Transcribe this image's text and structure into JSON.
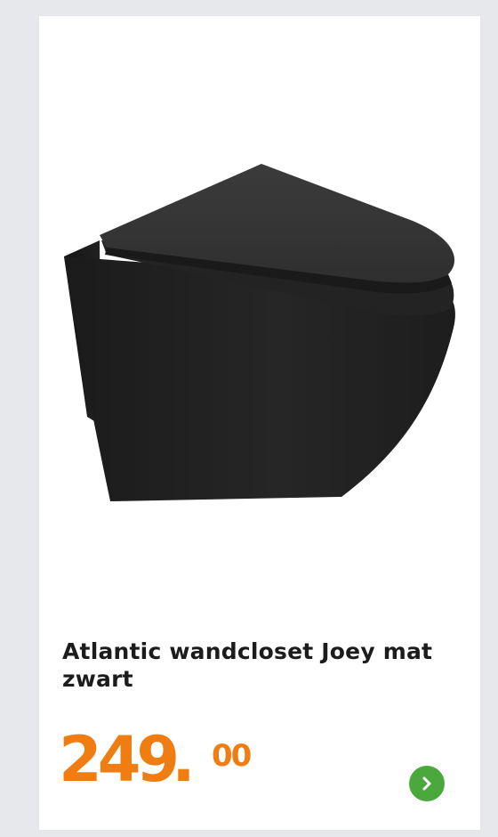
{
  "product": {
    "title": "Atlantic wandcloset Joey mat zwart",
    "price": {
      "main": "249",
      "dot": ".",
      "cents": "00"
    },
    "image_icon": "wall-toilet-image",
    "next_icon": "chevron-right-icon"
  },
  "colors": {
    "price": "#f07d12",
    "next_button": "#4aa83c",
    "background": "#e6e8ec",
    "card": "#ffffff"
  }
}
